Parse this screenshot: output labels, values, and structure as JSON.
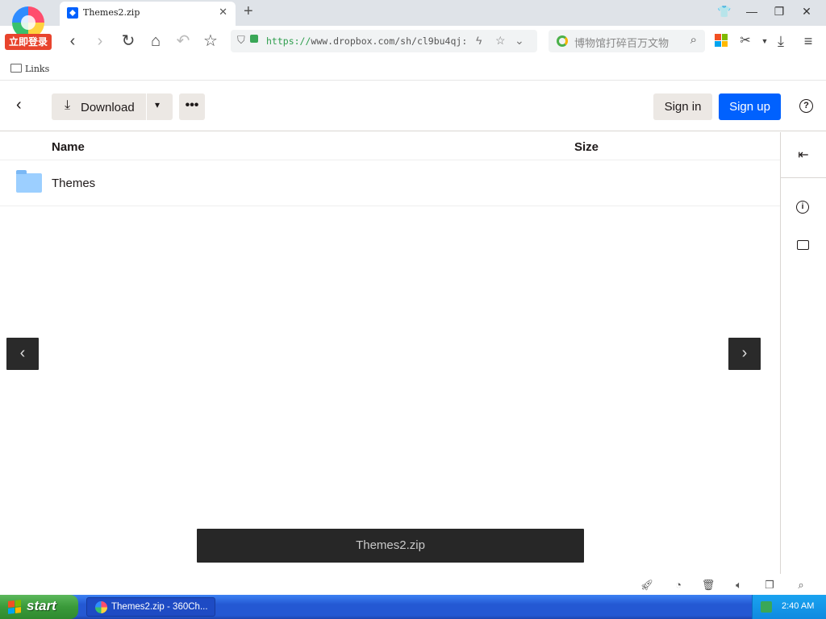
{
  "browser": {
    "login_badge": "立即登录",
    "tab_title": "Themes2.zip",
    "tab_close": "✕",
    "new_tab": "+",
    "url_scheme": "https://",
    "url_rest": "www.dropbox.com/sh/cl9bu4qj:",
    "search_placeholder": "博物馆打碎百万文物",
    "bookmark_folder": "Links"
  },
  "header": {
    "download_label": "Download",
    "sign_in_label": "Sign in",
    "sign_up_label": "Sign up"
  },
  "file_list": {
    "columns": [
      "Name",
      "Size"
    ],
    "rows": [
      {
        "name": "Themes",
        "size": ""
      }
    ]
  },
  "preview": {
    "file_name": "Themes2.zip"
  },
  "taskbar": {
    "start_label": "start",
    "task_item": "Themes2.zip - 360Ch...",
    "clock": "2:40 AM"
  },
  "icons": {
    "brand_blue": "#0061fe",
    "button_gray": "#ece8e4"
  }
}
